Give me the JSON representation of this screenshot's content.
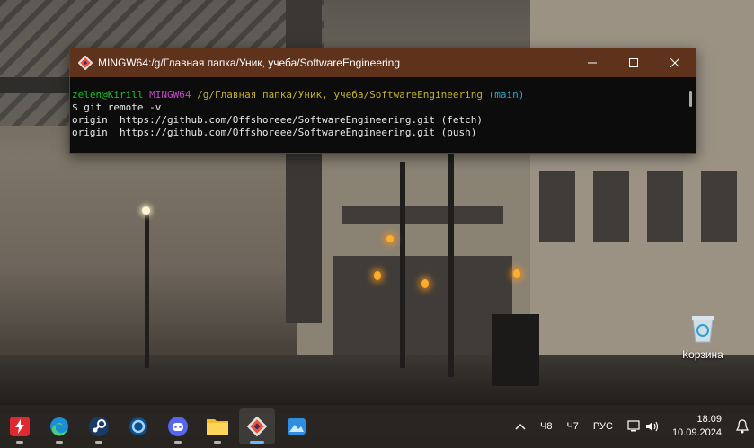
{
  "terminal": {
    "title": "MINGW64:/g/Главная папка/Уник, учеба/SoftwareEngineering",
    "prompt_user": "zelen@Kirill",
    "prompt_env": "MINGW64",
    "prompt_path": "/g/Главная папка/Уник, учеба/SoftwareEngineering",
    "prompt_branch": "(main)",
    "command": "$ git remote -v",
    "output": [
      "origin  https://github.com/Offshoreee/SoftwareEngineering.git (fetch)",
      "origin  https://github.com/Offshoreee/SoftwareEngineering.git (push)"
    ],
    "colors": {
      "titlebar": "#5e321b",
      "user": "#19c12a",
      "env": "#c04cc7",
      "path": "#c5b02a",
      "branch": "#29a7c9"
    }
  },
  "desktop": {
    "recycle_bin_label": "Корзина"
  },
  "taskbar": {
    "apps": [
      {
        "name": "bolt-app-icon",
        "active": false
      },
      {
        "name": "edge-icon",
        "active": false
      },
      {
        "name": "steam-icon",
        "active": false
      },
      {
        "name": "circle-app-icon",
        "active": false
      },
      {
        "name": "discord-icon",
        "active": false
      },
      {
        "name": "file-explorer-icon",
        "active": false
      },
      {
        "name": "git-bash-icon",
        "active": true
      },
      {
        "name": "photos-icon",
        "active": false
      }
    ],
    "tray": {
      "weather1": "Ч8",
      "weather2": "Ч7",
      "language": "РУС",
      "time": "18:09",
      "date": "10.09.2024"
    }
  }
}
